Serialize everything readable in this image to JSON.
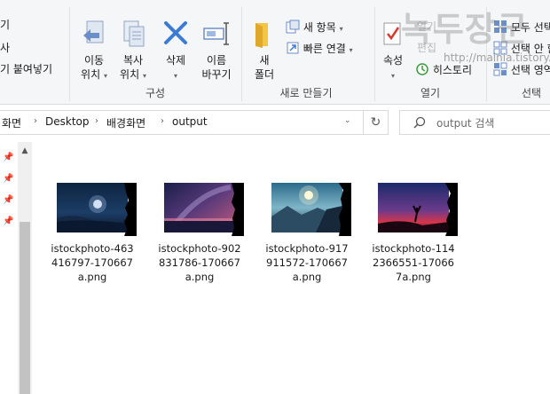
{
  "ribbon": {
    "clipboard_partial": {
      "line1": "기",
      "line2": "사",
      "line3": "기 붙여넣기"
    },
    "organize": {
      "move_to": [
        "이동",
        "위치"
      ],
      "copy_to": [
        "복사",
        "위치"
      ],
      "delete": "삭제",
      "rename": [
        "이름",
        "바꾸기"
      ],
      "group_label": "구성"
    },
    "new": {
      "new_folder": [
        "새",
        "폴더"
      ],
      "new_item": "새 항목",
      "easy_access": "빠른 연결",
      "group_label": "새로 만들기"
    },
    "open": {
      "properties": "속성",
      "open_label": "열기",
      "edit_label": "편집",
      "history": "히스토리",
      "group_label": "열기"
    },
    "select": {
      "select_all": "모두 선택",
      "select_none": "선택 안 함",
      "invert": "선택 영역 반전",
      "group_label": "선택"
    }
  },
  "address": {
    "crumbs": [
      "화면",
      "Desktop",
      "배경화면",
      "output"
    ],
    "search_placeholder": "output 검색"
  },
  "files": [
    {
      "name": "istockphoto-463416797-170667a.png",
      "lines": [
        "istockphoto-463",
        "416797-170667",
        "a.png"
      ]
    },
    {
      "name": "istockphoto-902831786-170667a.png",
      "lines": [
        "istockphoto-902",
        "831786-170667",
        "a.png"
      ]
    },
    {
      "name": "istockphoto-917911572-170667a.png",
      "lines": [
        "istockphoto-917",
        "911572-170667",
        "a.png"
      ]
    },
    {
      "name": "istockphoto-1142366551-170667a.png",
      "lines": [
        "istockphoto-114",
        "2366551-17066",
        "7a.png"
      ]
    }
  ],
  "watermark": {
    "title": "녹두장군",
    "url": "http://mainia.tistory.com"
  },
  "icons": [
    "move-to-icon",
    "copy-to-icon",
    "delete-icon",
    "rename-icon",
    "new-folder-icon",
    "new-item-icon",
    "easy-access-icon",
    "properties-icon",
    "history-icon",
    "select-all-icon",
    "refresh-icon",
    "search-icon",
    "pin-icon",
    "chevron-right-icon",
    "chevron-down-icon"
  ],
  "colors": {
    "ribbon_bg": "#f5f6f7",
    "folder_yellow": "#f4c542",
    "delete_blue": "#3a7bd5",
    "accent": "#0078d7"
  }
}
